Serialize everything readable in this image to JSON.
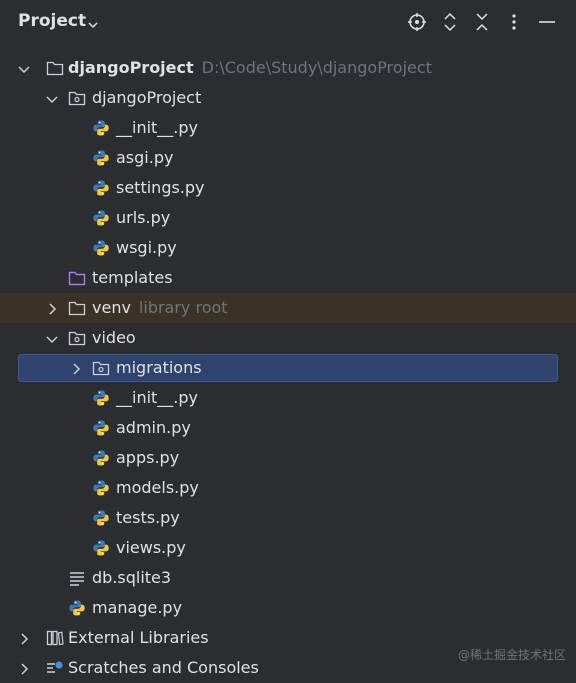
{
  "header": {
    "title": "Project",
    "actions": [
      "locate-icon",
      "expand-all-icon",
      "collapse-all-icon",
      "more-options-icon",
      "hide-icon"
    ]
  },
  "tree": [
    {
      "label": "djangoProject",
      "hint": "D:\\Code\\Study\\djangoProject",
      "type": "root-folder",
      "level": 0,
      "chevron": "down",
      "bold": true
    },
    {
      "label": "djangoProject",
      "type": "package",
      "level": 1,
      "chevron": "down"
    },
    {
      "label": "__init__.py",
      "type": "python",
      "level": 2
    },
    {
      "label": "asgi.py",
      "type": "python",
      "level": 2
    },
    {
      "label": "settings.py",
      "type": "python",
      "level": 2
    },
    {
      "label": "urls.py",
      "type": "python",
      "level": 2
    },
    {
      "label": "wsgi.py",
      "type": "python",
      "level": 2
    },
    {
      "label": "templates",
      "type": "template-folder",
      "level": 1
    },
    {
      "label": "venv",
      "hint": "library root",
      "type": "folder",
      "level": 1,
      "chevron": "right",
      "highlight": "venv"
    },
    {
      "label": "video",
      "type": "package",
      "level": 1,
      "chevron": "down"
    },
    {
      "label": "migrations",
      "type": "package",
      "level": 2,
      "chevron": "right",
      "selected": true
    },
    {
      "label": "__init__.py",
      "type": "python",
      "level": 2
    },
    {
      "label": "admin.py",
      "type": "python",
      "level": 2
    },
    {
      "label": "apps.py",
      "type": "python",
      "level": 2
    },
    {
      "label": "models.py",
      "type": "python",
      "level": 2
    },
    {
      "label": "tests.py",
      "type": "python",
      "level": 2
    },
    {
      "label": "views.py",
      "type": "python",
      "level": 2
    },
    {
      "label": "db.sqlite3",
      "type": "text-file",
      "level": 1
    },
    {
      "label": "manage.py",
      "type": "python",
      "level": 1
    },
    {
      "label": "External Libraries",
      "type": "libraries",
      "level": 0,
      "chevron": "right"
    },
    {
      "label": "Scratches and Consoles",
      "type": "scratches",
      "level": 0,
      "chevron": "right"
    }
  ],
  "watermark": "@稀土掘金技术社区",
  "colors": {
    "background": "#2b2d30",
    "selection": "#2e436e",
    "venv_highlight": "#3a3226",
    "text": "#dfe1e5",
    "hint": "#6f737a"
  }
}
